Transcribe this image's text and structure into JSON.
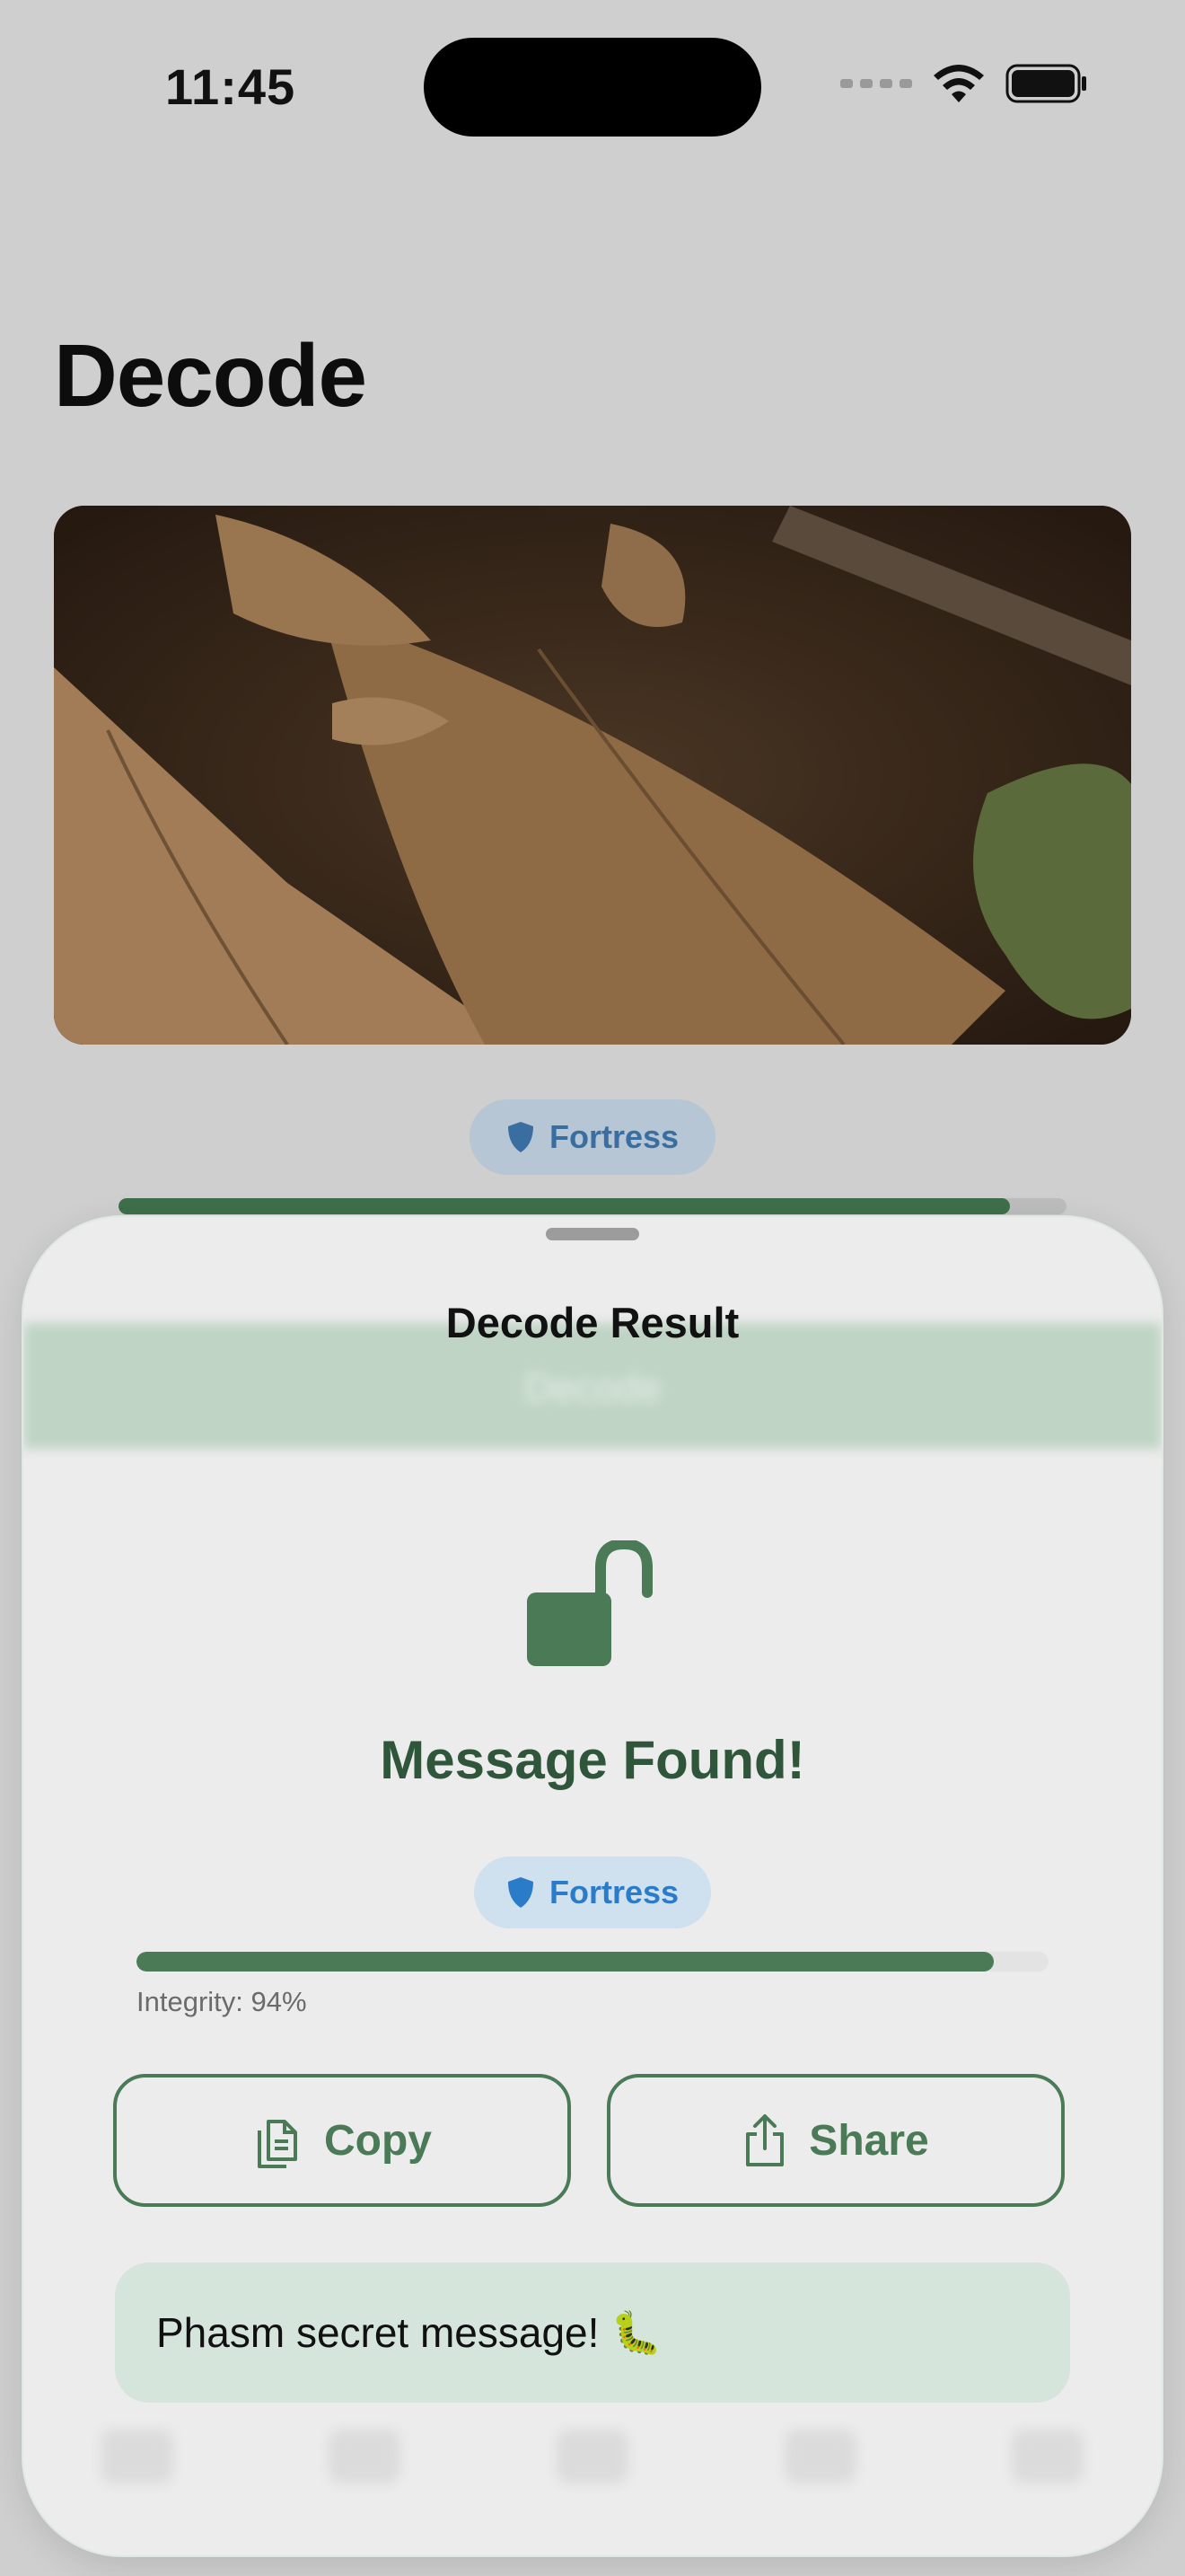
{
  "status_bar": {
    "time": "11:45"
  },
  "page": {
    "title": "Decode"
  },
  "background": {
    "badge_label": "Fortress",
    "progress_fraction": 0.94
  },
  "sheet": {
    "title": "Decode Result",
    "ghost_button_label": "Decode",
    "heading": "Message Found!",
    "badge_label": "Fortress",
    "integrity_fraction": 0.94,
    "integrity_text": "Integrity: 94%",
    "copy_label": "Copy",
    "share_label": "Share",
    "message": "Phasm secret message! 🐛"
  },
  "colors": {
    "accent_green": "#4a7a56",
    "badge_blue": "#2a7bc8",
    "message_bg": "#d6e5dc"
  },
  "icons": [
    "wifi-icon",
    "battery-icon",
    "shield-icon",
    "unlock-icon",
    "copy-icon",
    "share-icon"
  ]
}
